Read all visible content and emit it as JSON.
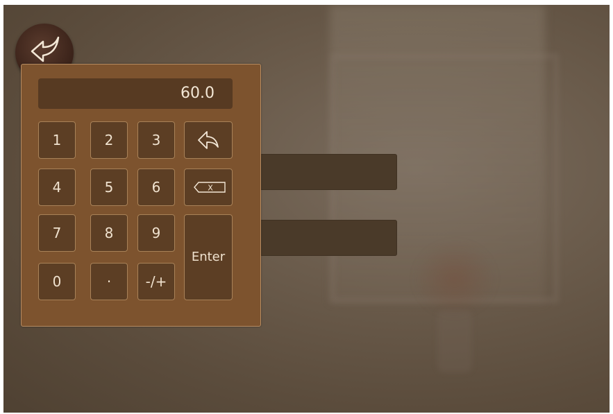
{
  "display": {
    "value": "60.0"
  },
  "keys": {
    "k1": "1",
    "k2": "2",
    "k3": "3",
    "k4": "4",
    "k5": "5",
    "k6": "6",
    "k7": "7",
    "k8": "8",
    "k9": "9",
    "k0": "0",
    "dot": "·",
    "sign": "-/+",
    "enter": "Enter",
    "backspace_mark": "X"
  },
  "icons": {
    "back": "return-arrow-icon",
    "undo": "undo-arrow-icon",
    "backspace": "backspace-icon"
  },
  "colors": {
    "panel": "#7d532e",
    "key": "#5c3e24",
    "display": "#573a22",
    "text": "#f0e2cf",
    "backdrop_bar": "#4a3a29"
  }
}
